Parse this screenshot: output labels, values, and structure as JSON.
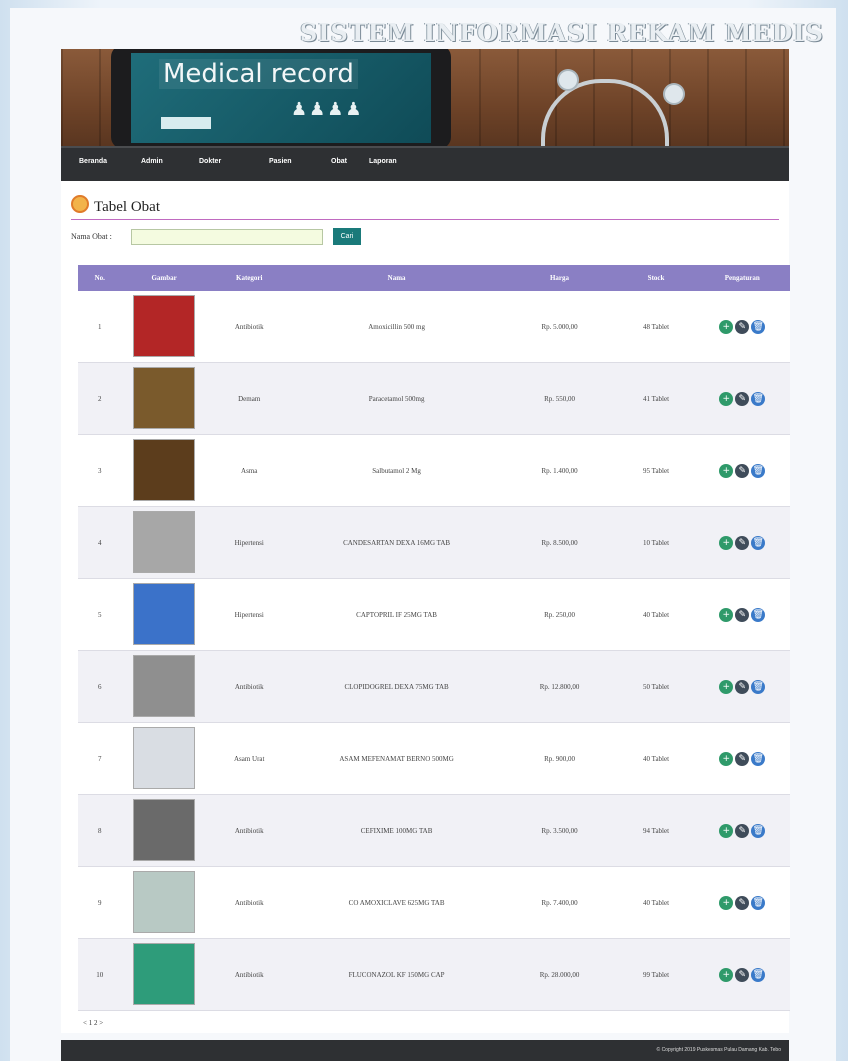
{
  "header": {
    "site_title": "SISTEM INFORMASI REKAM MEDIS",
    "banner_text": "Medical record"
  },
  "nav": {
    "items": [
      "Beranda",
      "Admin",
      "Dokter",
      "Pasien",
      "Obat",
      "Laporan"
    ]
  },
  "page": {
    "title": "Tabel Obat",
    "search_label": "Nama Obat :",
    "search_value": "",
    "search_button": "Cari"
  },
  "table": {
    "headers": [
      "No.",
      "Gambar",
      "Kategori",
      "Nama",
      "Harga",
      "Stock",
      "Pengaturan"
    ],
    "rows": [
      {
        "no": "1",
        "kategori": "Antibiotik",
        "nama": "Amoxicillin 500 mg",
        "harga": "Rp. 5.000,00",
        "stock": "48 Tablet",
        "img": "#b32626"
      },
      {
        "no": "2",
        "kategori": "Demam",
        "nama": "Paracetamol 500mg",
        "harga": "Rp. 550,00",
        "stock": "41 Tablet",
        "img": "#7a5a2c"
      },
      {
        "no": "3",
        "kategori": "Asma",
        "nama": "Salbutamol 2 Mg",
        "harga": "Rp. 1.400,00",
        "stock": "95 Tablet",
        "img": "#5c3d1c"
      },
      {
        "no": "4",
        "kategori": "Hipertensi",
        "nama": "CANDESARTAN DEXA 16MG TAB",
        "harga": "Rp. 8.500,00",
        "stock": "10 Tablet",
        "img": "#a7a7a7"
      },
      {
        "no": "5",
        "kategori": "Hipertensi",
        "nama": "CAPTOPRIL IF 25MG TAB",
        "harga": "Rp. 250,00",
        "stock": "40 Tablet",
        "img": "#3b72c9"
      },
      {
        "no": "6",
        "kategori": "Antibiotik",
        "nama": "CLOPIDOGREL DEXA 75MG TAB",
        "harga": "Rp. 12.800,00",
        "stock": "50 Tablet",
        "img": "#8f8f8f"
      },
      {
        "no": "7",
        "kategori": "Asam Urat",
        "nama": "ASAM MEFENAMAT BERNO 500MG",
        "harga": "Rp. 900,00",
        "stock": "40 Tablet",
        "img": "#d9dde3"
      },
      {
        "no": "8",
        "kategori": "Antibiotik",
        "nama": "CEFIXIME 100MG TAB",
        "harga": "Rp. 3.500,00",
        "stock": "94 Tablet",
        "img": "#6a6a6a"
      },
      {
        "no": "9",
        "kategori": "Antibiotik",
        "nama": "CO AMOXICLAVE 625MG TAB",
        "harga": "Rp. 7.400,00",
        "stock": "40 Tablet",
        "img": "#b8c9c4"
      },
      {
        "no": "10",
        "kategori": "Antibiotik",
        "nama": "FLUCONAZOL KF 150MG CAP",
        "harga": "Rp. 28.000,00",
        "stock": "99 Tablet",
        "img": "#2e9c7a"
      }
    ]
  },
  "pagination": {
    "text": "< 1 2 >"
  },
  "footer": {
    "copyright": "© Copyright 2019 Puskesmas Pulau Damang Kab. Tebo"
  },
  "colors": {
    "nav_bg": "#2e3033",
    "table_header": "#8a7fc4",
    "button": "#1a7a7a"
  }
}
